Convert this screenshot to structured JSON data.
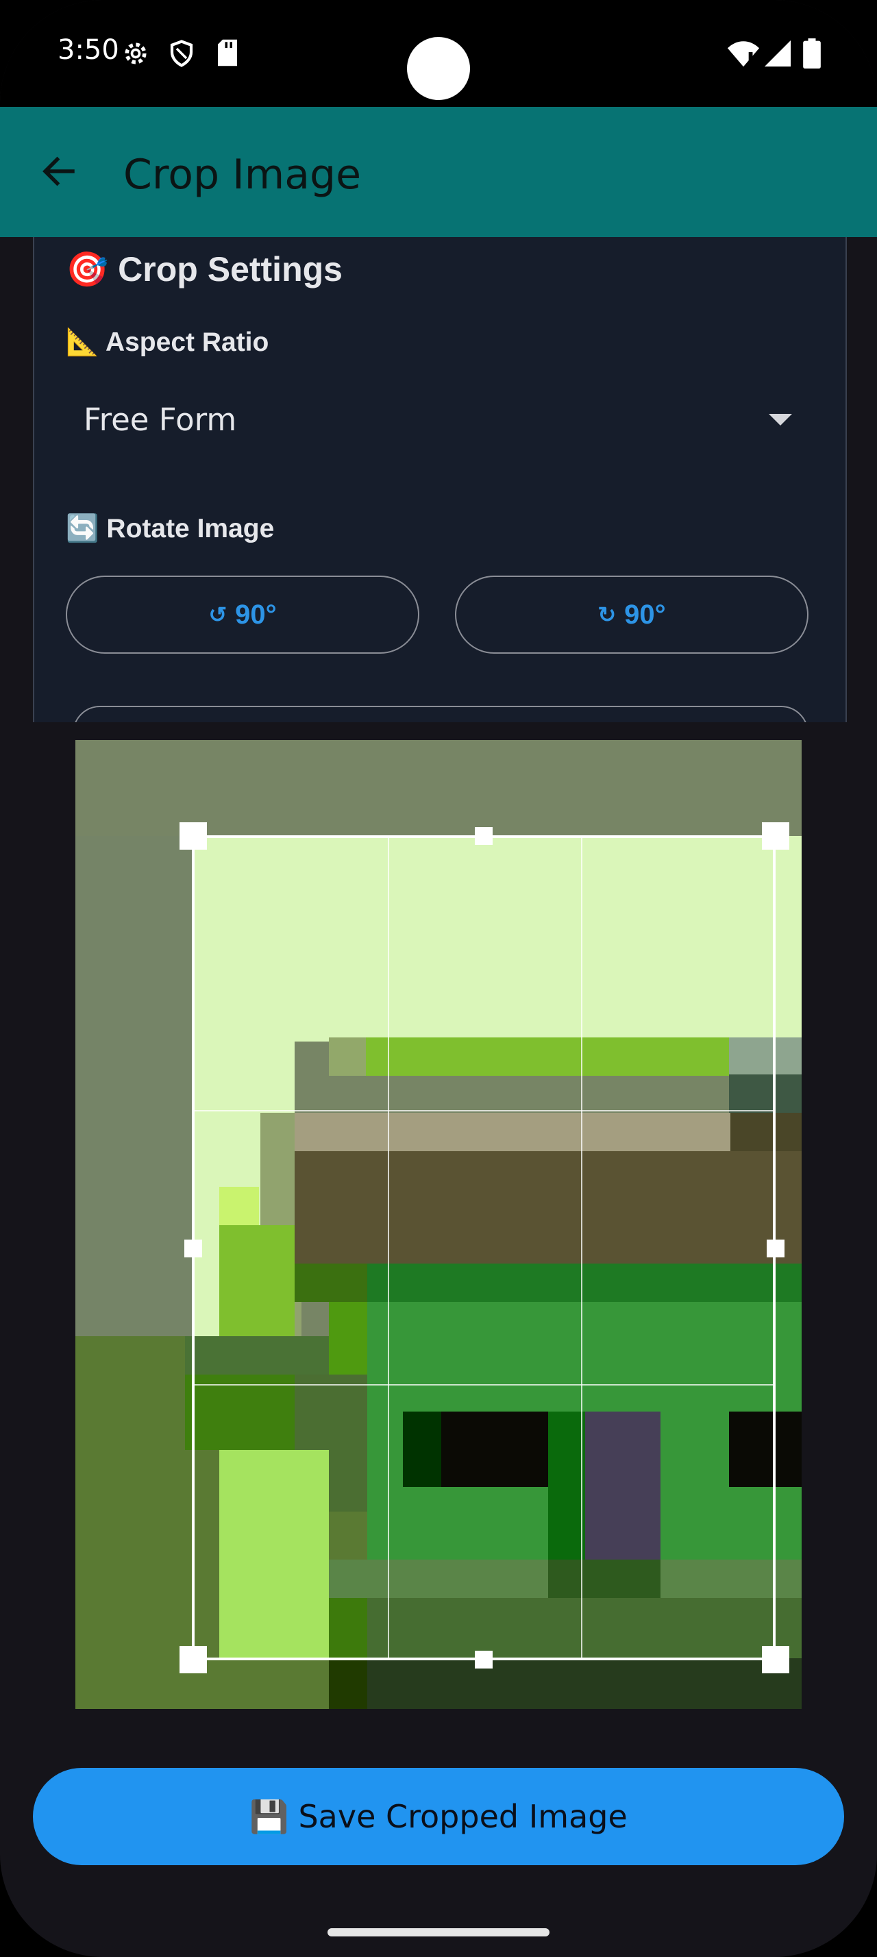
{
  "status_bar": {
    "time": "3:50",
    "icons": [
      "gear-icon",
      "shield-icon",
      "sd-card-icon",
      "wifi-icon",
      "signal-icon",
      "battery-icon"
    ]
  },
  "app_bar": {
    "title": "Crop Image",
    "back_icon": "arrow-left-icon",
    "color": "#077373"
  },
  "crop_settings": {
    "title_emoji": "🎯",
    "title": "Crop Settings",
    "aspect_ratio": {
      "emoji": "📐",
      "label": "Aspect Ratio",
      "selected": "Free Form"
    },
    "rotate": {
      "emoji": "🔄",
      "label": "Rotate Image",
      "left_symbol": "↺",
      "left_label": "90°",
      "right_symbol": "↻",
      "right_label": "90°"
    }
  },
  "save_button": {
    "emoji": "💾",
    "label": "Save Cropped Image",
    "color": "#2194f0"
  }
}
